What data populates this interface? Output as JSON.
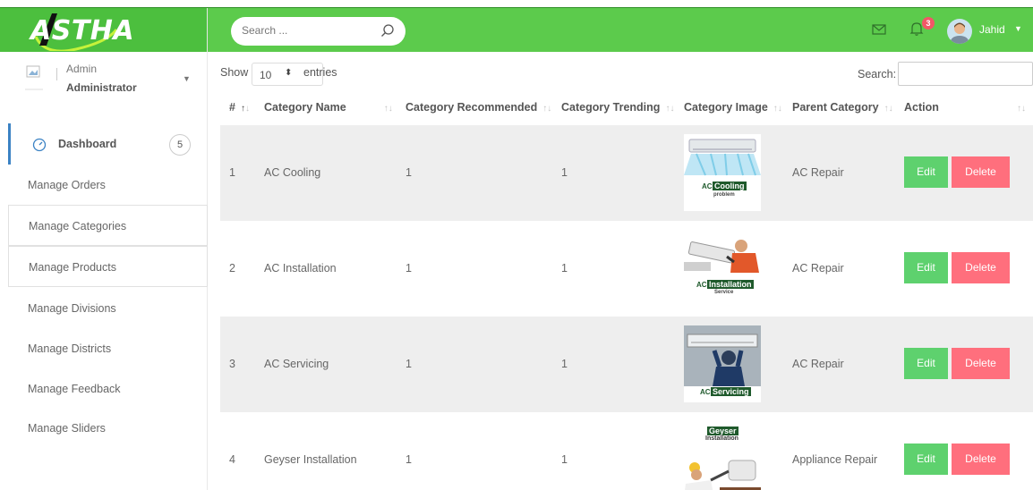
{
  "brand": {
    "logo_text": "ASTHA"
  },
  "header": {
    "search_placeholder": "Search ...",
    "notification_count": "3",
    "user_name": "Jahid",
    "accent_color": "#5ccb4c"
  },
  "profile": {
    "role": "Admin",
    "name": "Administrator"
  },
  "sidebar": {
    "items": [
      {
        "label": "Dashboard",
        "count": "5"
      },
      {
        "label": "Manage Orders"
      },
      {
        "label": "Manage Categories"
      },
      {
        "label": "Manage Products"
      },
      {
        "label": "Manage Divisions"
      },
      {
        "label": "Manage Districts"
      },
      {
        "label": "Manage Feedback"
      },
      {
        "label": "Manage Sliders"
      }
    ]
  },
  "table_controls": {
    "show_label": "Show",
    "page_length": "10",
    "entries_label": "entries",
    "search_label": "Search:"
  },
  "table": {
    "columns": [
      "#",
      "Category Name",
      "Category Recommended",
      "Category Trending",
      "Category Image",
      "Parent Category",
      "Action"
    ],
    "rows": [
      {
        "id": "1",
        "name": "AC Cooling",
        "recommended": "1",
        "trending": "1",
        "image_caption": [
          "AC",
          "Cooling",
          "problem"
        ],
        "parent": "AC Repair"
      },
      {
        "id": "2",
        "name": "AC Installation",
        "recommended": "1",
        "trending": "1",
        "image_caption": [
          "AC",
          "Installation",
          "Service"
        ],
        "parent": "AC Repair"
      },
      {
        "id": "3",
        "name": "AC Servicing",
        "recommended": "1",
        "trending": "1",
        "image_caption": [
          "AC",
          "Servicing"
        ],
        "parent": "AC Repair"
      },
      {
        "id": "4",
        "name": "Geyser Installation",
        "recommended": "1",
        "trending": "1",
        "image_caption": [
          "Geyser",
          "Installation"
        ],
        "parent": "Appliance Repair"
      }
    ],
    "edit_label": "Edit",
    "delete_label": "Delete",
    "edit_color": "#5ed16e",
    "delete_color": "#ff6f7d"
  }
}
